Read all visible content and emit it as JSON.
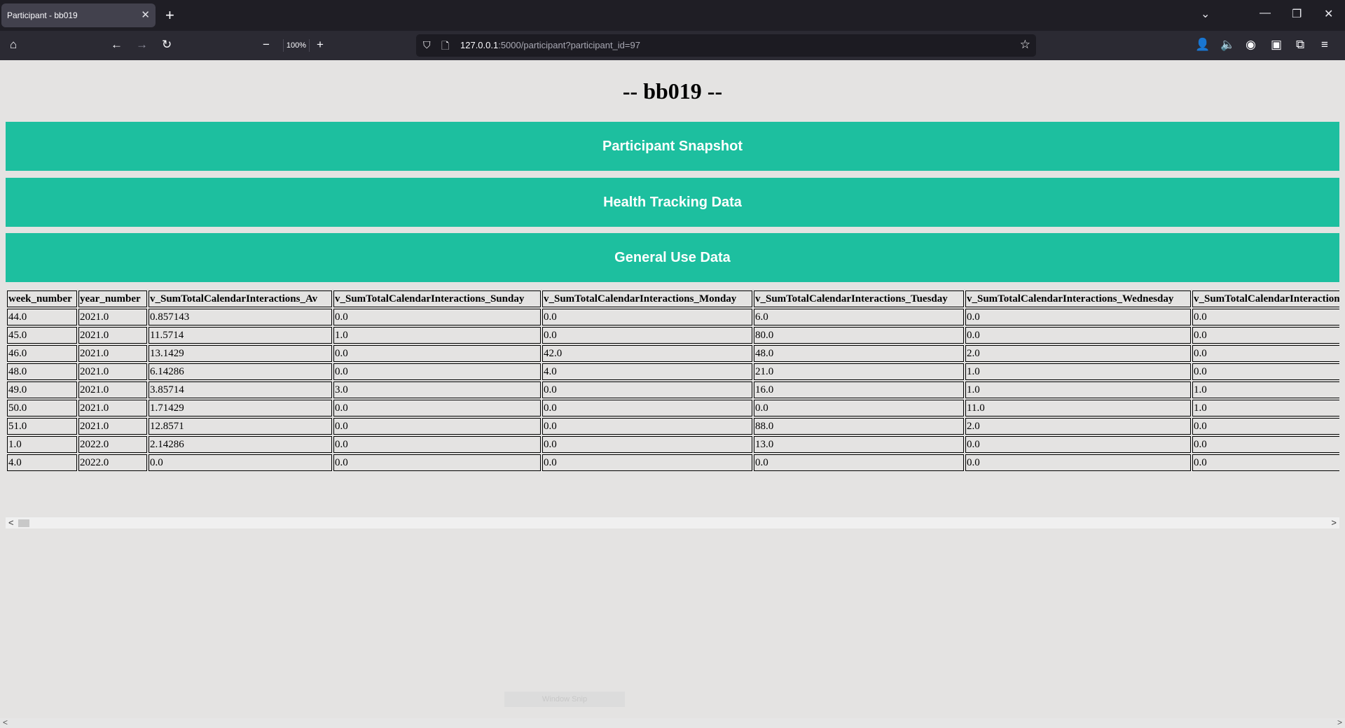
{
  "browser": {
    "tab_title": "Participant - bb019",
    "tab_close": "✕",
    "new_tab": "+",
    "zoom": "100%",
    "url_host": "127.0.0.1",
    "url_rest": ":5000/participant?participant_id=97"
  },
  "page": {
    "title": "-- bb019 --",
    "sections": {
      "snapshot": "Participant Snapshot",
      "health": "Health Tracking Data",
      "general": "General Use Data"
    },
    "snip_label": "Window Snip"
  },
  "table": {
    "headers": [
      "week_number",
      "year_number",
      "v_SumTotalCalendarInteractions_Av",
      "v_SumTotalCalendarInteractions_Sunday",
      "v_SumTotalCalendarInteractions_Monday",
      "v_SumTotalCalendarInteractions_Tuesday",
      "v_SumTotalCalendarInteractions_Wednesday",
      "v_SumTotalCalendarInteraction"
    ],
    "rows": [
      [
        "44.0",
        "2021.0",
        "0.857143",
        "0.0",
        "0.0",
        "6.0",
        "0.0",
        "0.0"
      ],
      [
        "45.0",
        "2021.0",
        "11.5714",
        "1.0",
        "0.0",
        "80.0",
        "0.0",
        "0.0"
      ],
      [
        "46.0",
        "2021.0",
        "13.1429",
        "0.0",
        "42.0",
        "48.0",
        "2.0",
        "0.0"
      ],
      [
        "48.0",
        "2021.0",
        "6.14286",
        "0.0",
        "4.0",
        "21.0",
        "1.0",
        "0.0"
      ],
      [
        "49.0",
        "2021.0",
        "3.85714",
        "3.0",
        "0.0",
        "16.0",
        "1.0",
        "1.0"
      ],
      [
        "50.0",
        "2021.0",
        "1.71429",
        "0.0",
        "0.0",
        "0.0",
        "11.0",
        "1.0"
      ],
      [
        "51.0",
        "2021.0",
        "12.8571",
        "0.0",
        "0.0",
        "88.0",
        "2.0",
        "0.0"
      ],
      [
        "1.0",
        "2022.0",
        "2.14286",
        "0.0",
        "0.0",
        "13.0",
        "0.0",
        "0.0"
      ],
      [
        "4.0",
        "2022.0",
        "0.0",
        "0.0",
        "0.0",
        "0.0",
        "0.0",
        "0.0"
      ]
    ]
  },
  "colors": {
    "section_button": "#1dbf9f",
    "page_background": "#e4e3e2"
  }
}
